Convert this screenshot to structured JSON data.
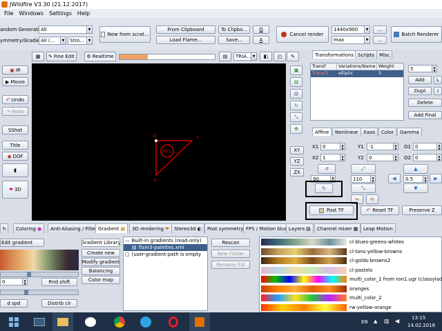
{
  "window": {
    "title": "JWildfire V3.30 (21.12.2017)"
  },
  "menu": [
    "File",
    "Windows",
    "Settings",
    "Help"
  ],
  "top": {
    "random_generator_label": "andom Generator",
    "random_generator_value": "All",
    "symmetry_label": "ymmetry/Gradient",
    "symmetry_value": "All (...",
    "gradient_value": "Stro...",
    "new_from_scratch": "New from scrat...",
    "from_clipboard": "From Clipboard",
    "to_clipboard": "To Clipbo...",
    "load_flame": "Load Flame...",
    "save": "Save...",
    "q_label": "Q",
    "a_label": "A",
    "cancel_render": "Cancel render",
    "resolution": "1440x900",
    "quality": "max",
    "more": "...",
    "batch_renderer": "Batch Renderer"
  },
  "toolbar": {
    "fine_edit": "Fine Edit",
    "realtime": "Realtime",
    "shape_combo": "TRIA...",
    "progress": 0.3
  },
  "left_buttons": {
    "ir": "IR",
    "movie": "Movie",
    "undo": "Undo",
    "redo": "Redo",
    "sshot": "SShot",
    "title": "Title",
    "dof": "DOF",
    "three_d": "3D"
  },
  "canvas": {
    "triangle_label": "PT1",
    "origin_label": "O",
    "y_label": "Y",
    "x_label": "X"
  },
  "axis_buttons": {
    "xy": "XY",
    "yz": "YZ",
    "zx": "ZX"
  },
  "right_tabs": [
    "Transformations",
    "Scripts",
    "Misc"
  ],
  "transforms_table": {
    "headers": [
      "Transf",
      "Variations/Name",
      "Weight"
    ],
    "rows": [
      [
        "Transf1",
        "elliptic",
        "5"
      ]
    ]
  },
  "transform_controls": {
    "count": "5",
    "add": "Add",
    "dupl": "Dupl",
    "delete": "Delete",
    "add_final": "Add Final",
    "l_btn": "L",
    "i_btn": "I"
  },
  "affine_tabs": [
    "Affine",
    "Nonlinear",
    "Xaos",
    "Color",
    "Gamma"
  ],
  "affine": {
    "x1_label": "X1",
    "x1": "0",
    "y1_label": "Y1",
    "y1": "-1",
    "o1_label": "O1",
    "o1": "0",
    "x2_label": "X2",
    "x2": "1",
    "y2_label": "Y2",
    "y2": "0",
    "o2_label": "O2",
    "o2": "0",
    "rotate": "90",
    "scale": "110",
    "move": "0.5",
    "post_tf": "Post TF",
    "reset_tf": "Reset TF",
    "preserve_z": "Preserve Z"
  },
  "bottom_tabs": [
    "h",
    "Coloring",
    "Anti-Aliasing / Filter",
    "Gradient",
    "3D rendering",
    "Stereo3d",
    "Post symmetry",
    "FPS / Motion blur",
    "Layers",
    "Channel mixer",
    "Leap Motion"
  ],
  "gradient_panel": {
    "edit_gradient": "Edit gradient",
    "shift_value": "0",
    "rnd_shift": "Rnd shift",
    "d_spd": "d spd",
    "distrib_clr": "Distrib clr",
    "library": "Gradient Library",
    "create_new": "Create new",
    "modify": "Modify gradient",
    "balancing": "Balancing",
    "color_map": "Color map",
    "tree_root": "Built-in gradients (read-only)",
    "tree_file": "flam3-palettes.xml",
    "tree_user": "(user-gradient-path is empty",
    "rescan": "Rescan",
    "new_folder": "New Folder",
    "rename": "Rename Fld"
  },
  "gradients": [
    {
      "name": "cl-blues-greens-whites",
      "colors": [
        "#2b2b58",
        "#3e6a7a",
        "#7fa58a",
        "#d8d8c8",
        "#6d8fa0",
        "#e8e8e0"
      ]
    },
    {
      "name": "cl-tans-yellow-browns",
      "colors": [
        "#6b4a2a",
        "#c9a060",
        "#e8d070",
        "#9b6a3a",
        "#d8b880",
        "#5a3a20"
      ]
    },
    {
      "name": "cl-golds-browns2",
      "colors": [
        "#3a2410",
        "#b07a20",
        "#e0b040",
        "#7a4a18",
        "#d0a050",
        "#4a2a10"
      ]
    },
    {
      "name": "cl-pastels",
      "colors": [
        "#e8b8c8",
        "#b8d8e8",
        "#f0e0a8",
        "#c8e8b8",
        "#d8c0e8",
        "#f8d0b0"
      ]
    },
    {
      "name": "multi_color_1 from ron1.ugr (classylady...",
      "colors": [
        "#ff0000",
        "#00c000",
        "#0000ff",
        "#ffff00",
        "#ff00ff",
        "#00ffff",
        "#ff8000"
      ]
    },
    {
      "name": "oranges",
      "colors": [
        "#c84000",
        "#ff8000",
        "#ffb040",
        "#e06000",
        "#ff9020",
        "#a03000"
      ]
    },
    {
      "name": "multi_color_2",
      "colors": [
        "#ff2020",
        "#20a0ff",
        "#ffe020",
        "#20c040",
        "#c020ff",
        "#ff8020"
      ]
    },
    {
      "name": "rw-yellow-orange",
      "colors": [
        "#ff3000",
        "#ffd000",
        "#ff8000",
        "#ffff40",
        "#ff6000"
      ]
    }
  ],
  "taskbar": {
    "lang": "EN",
    "time": "13:15",
    "date": "14.02.2018"
  }
}
